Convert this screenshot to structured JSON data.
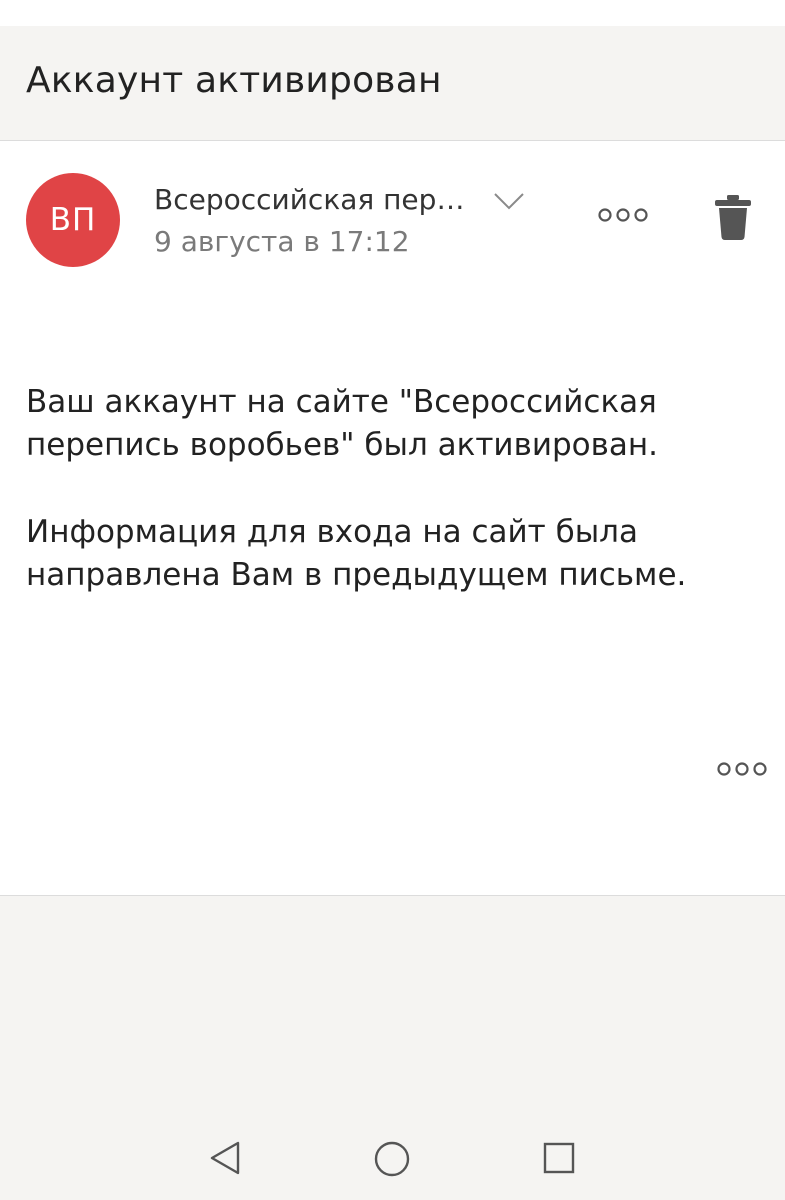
{
  "header": {
    "title": "Аккаунт активирован"
  },
  "message": {
    "avatar_initials": "ВП",
    "avatar_color": "#e04446",
    "sender": "Всероссийская пере...",
    "date": "9 августа в 17:12",
    "paragraphs": [
      "Ваш аккаунт на сайте \"Всероссийская перепись воробьев\" был активирован.",
      "Информация для входа на сайт была направлена Вам в предыдущем письме."
    ]
  },
  "icons": {
    "expand": "chevron-down-icon",
    "more": "more-horizontal-icon",
    "delete": "trash-icon",
    "back": "back-triangle-icon",
    "home": "home-circle-icon",
    "recent": "recent-square-icon"
  }
}
